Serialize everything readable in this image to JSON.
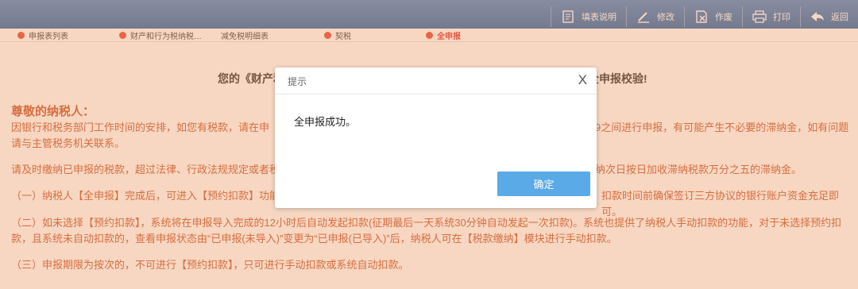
{
  "toolbar": {
    "buttons": [
      {
        "label": "填表说明",
        "icon": "help-doc-icon"
      },
      {
        "label": "修改",
        "icon": "edit-icon"
      },
      {
        "label": "作废",
        "icon": "void-icon"
      },
      {
        "label": "打印",
        "icon": "print-icon"
      },
      {
        "label": "返回",
        "icon": "back-icon"
      }
    ]
  },
  "tabs": [
    {
      "label": "申报表列表",
      "has_dot": true
    },
    {
      "label": "财产和行为税纳税…",
      "has_dot": true
    },
    {
      "label": "减免税明细表",
      "has_dot": false
    },
    {
      "label": "契税",
      "has_dot": true
    },
    {
      "label": "全申报",
      "has_dot": true,
      "active": true
    }
  ],
  "main": {
    "headline_left": "您的《财产和",
    "headline_right": "全申报校验!",
    "greeting": "尊敬的纳税人：",
    "p1_left": "因银行和税务部门工作时间的安排，如您有税款，请在申",
    "p1_right": "9之间进行申报，有可能产生不必要的滞纳金，如有问题",
    "p1_line2": "请与主管税务机关联系。",
    "p2_left": "请及时缴纳已申报的税款，超过法律、行政法规规定或者税",
    "p2_right": "纳次日按日加收滞纳税款万分之五的滞纳金。",
    "p3_left": "（一）纳税人【全申报】完成后，可进入【预约扣款】功能",
    "p3_right": "扣款时间前确保签订三方协议的银行账户资金充足即可。",
    "p4_line1": "（二）如未选择【预约扣款】，系统将在申报导入完成的12小时后自动发起扣款(征期最后一天系统30分钟自动发起一次扣款)。系统也提供了纳税人手动扣款的功能，对于未选择预约扣",
    "p4_line2": "款，且系统未自动扣款的，查看申报状态由“已申报(未导入)”变更为“已申报(已导入)”后，纳税人可在【税款缴纳】模块进行手动扣款。",
    "p5": "（三）申报期限为按次的，不可进行【预约扣款】，只可进行手动扣款或系统自动扣款。"
  },
  "dialog": {
    "title": "提示",
    "close_label": "X",
    "message": "全申报成功。",
    "ok_label": "确定"
  },
  "colors": {
    "accent": "#1e5fa6",
    "warning_text": "#c84a1e",
    "ok_button": "#5aaae8",
    "tab_dot": "#e53a2a"
  }
}
